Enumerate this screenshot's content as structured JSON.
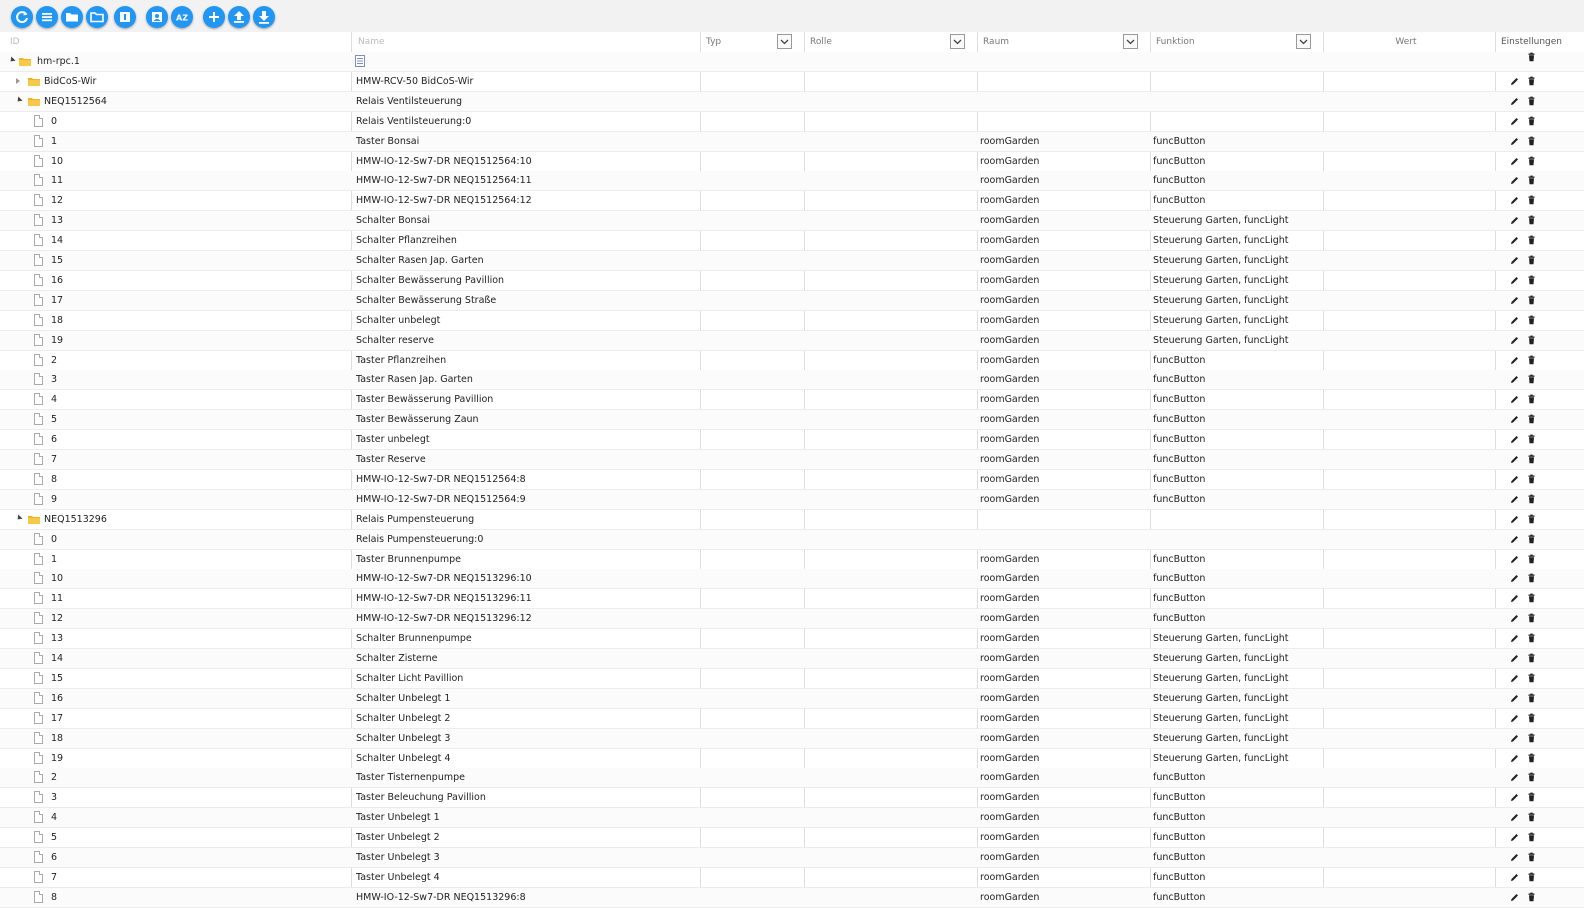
{
  "toolbar": {
    "buttons": [
      {
        "name": "refresh-button",
        "icon": "refresh-icon"
      },
      {
        "name": "list-view-button",
        "icon": "list-icon"
      },
      {
        "name": "collapse-folders-button",
        "icon": "folder-closed-icon"
      },
      {
        "name": "expand-folders-button",
        "icon": "folder-open-icon"
      },
      {
        "name": "column-toggle-button",
        "icon": "columns-icon"
      },
      {
        "name": "edit-person-button",
        "icon": "person-icon"
      },
      {
        "name": "sort-az-button",
        "icon": "sort-az-icon",
        "text": "AZ"
      },
      {
        "name": "add-object-button",
        "icon": "plus-icon"
      },
      {
        "name": "upload-button",
        "icon": "upload-icon"
      },
      {
        "name": "download-button",
        "icon": "download-icon"
      }
    ],
    "accent": "#2196f3"
  },
  "header": {
    "id_placeholder": "ID",
    "name_placeholder": "Name",
    "typ": "Typ",
    "rolle": "Rolle",
    "raum": "Raum",
    "funktion": "Funktion",
    "wert": "Wert",
    "einstellungen": "Einstellungen"
  },
  "rows": [
    {
      "id": "hm-rpc.1",
      "level": 0,
      "kind": "folder",
      "toggle": "open",
      "name": "",
      "name_icon": true,
      "raum": "",
      "funktion": "",
      "delete_only": true
    },
    {
      "id": "BidCoS-Wir",
      "level": 1,
      "kind": "folder",
      "toggle": "closed",
      "name": "HMW-RCV-50 BidCoS-Wir",
      "raum": "",
      "funktion": ""
    },
    {
      "id": "NEQ1512564",
      "level": 1,
      "kind": "folder",
      "toggle": "open",
      "name": "Relais Ventilsteuerung",
      "raum": "",
      "funktion": ""
    },
    {
      "id": "0",
      "level": 2,
      "kind": "file",
      "name": "Relais Ventilsteuerung:0",
      "raum": "",
      "funktion": ""
    },
    {
      "id": "1",
      "level": 2,
      "kind": "file",
      "name": "Taster Bonsai",
      "raum": "roomGarden",
      "funktion": "funcButton"
    },
    {
      "id": "10",
      "level": 2,
      "kind": "file",
      "name": "HMW-IO-12-Sw7-DR NEQ1512564:10",
      "raum": "roomGarden",
      "funktion": "funcButton"
    },
    {
      "id": "11",
      "level": 2,
      "kind": "file",
      "name": "HMW-IO-12-Sw7-DR NEQ1512564:11",
      "raum": "roomGarden",
      "funktion": "funcButton"
    },
    {
      "id": "12",
      "level": 2,
      "kind": "file",
      "name": "HMW-IO-12-Sw7-DR NEQ1512564:12",
      "raum": "roomGarden",
      "funktion": "funcButton"
    },
    {
      "id": "13",
      "level": 2,
      "kind": "file",
      "name": "Schalter Bonsai",
      "raum": "roomGarden",
      "funktion": "Steuerung Garten, funcLight"
    },
    {
      "id": "14",
      "level": 2,
      "kind": "file",
      "name": "Schalter Pflanzreihen",
      "raum": "roomGarden",
      "funktion": "Steuerung Garten, funcLight"
    },
    {
      "id": "15",
      "level": 2,
      "kind": "file",
      "name": "Schalter Rasen Jap. Garten",
      "raum": "roomGarden",
      "funktion": "Steuerung Garten, funcLight"
    },
    {
      "id": "16",
      "level": 2,
      "kind": "file",
      "name": "Schalter Bewässerung Pavillion",
      "raum": "roomGarden",
      "funktion": "Steuerung Garten, funcLight"
    },
    {
      "id": "17",
      "level": 2,
      "kind": "file",
      "name": "Schalter Bewässerung Straße",
      "raum": "roomGarden",
      "funktion": "Steuerung Garten, funcLight"
    },
    {
      "id": "18",
      "level": 2,
      "kind": "file",
      "name": "Schalter unbelegt",
      "raum": "roomGarden",
      "funktion": "Steuerung Garten, funcLight"
    },
    {
      "id": "19",
      "level": 2,
      "kind": "file",
      "name": "Schalter reserve",
      "raum": "roomGarden",
      "funktion": "Steuerung Garten, funcLight"
    },
    {
      "id": "2",
      "level": 2,
      "kind": "file",
      "name": "Taster Pflanzreihen",
      "raum": "roomGarden",
      "funktion": "funcButton"
    },
    {
      "id": "3",
      "level": 2,
      "kind": "file",
      "name": "Taster Rasen Jap. Garten",
      "raum": "roomGarden",
      "funktion": "funcButton"
    },
    {
      "id": "4",
      "level": 2,
      "kind": "file",
      "name": "Taster Bewässerung Pavillion",
      "raum": "roomGarden",
      "funktion": "funcButton"
    },
    {
      "id": "5",
      "level": 2,
      "kind": "file",
      "name": "Taster Bewässerung Zaun",
      "raum": "roomGarden",
      "funktion": "funcButton"
    },
    {
      "id": "6",
      "level": 2,
      "kind": "file",
      "name": "Taster unbelegt",
      "raum": "roomGarden",
      "funktion": "funcButton"
    },
    {
      "id": "7",
      "level": 2,
      "kind": "file",
      "name": "Taster Reserve",
      "raum": "roomGarden",
      "funktion": "funcButton"
    },
    {
      "id": "8",
      "level": 2,
      "kind": "file",
      "name": "HMW-IO-12-Sw7-DR NEQ1512564:8",
      "raum": "roomGarden",
      "funktion": "funcButton"
    },
    {
      "id": "9",
      "level": 2,
      "kind": "file",
      "name": "HMW-IO-12-Sw7-DR NEQ1512564:9",
      "raum": "roomGarden",
      "funktion": "funcButton"
    },
    {
      "id": "NEQ1513296",
      "level": 1,
      "kind": "folder",
      "toggle": "open",
      "name": "Relais Pumpensteuerung",
      "raum": "",
      "funktion": ""
    },
    {
      "id": "0",
      "level": 2,
      "kind": "file",
      "name": "Relais Pumpensteuerung:0",
      "raum": "",
      "funktion": ""
    },
    {
      "id": "1",
      "level": 2,
      "kind": "file",
      "name": "Taster Brunnenpumpe",
      "raum": "roomGarden",
      "funktion": "funcButton"
    },
    {
      "id": "10",
      "level": 2,
      "kind": "file",
      "name": "HMW-IO-12-Sw7-DR NEQ1513296:10",
      "raum": "roomGarden",
      "funktion": "funcButton"
    },
    {
      "id": "11",
      "level": 2,
      "kind": "file",
      "name": "HMW-IO-12-Sw7-DR NEQ1513296:11",
      "raum": "roomGarden",
      "funktion": "funcButton"
    },
    {
      "id": "12",
      "level": 2,
      "kind": "file",
      "name": "HMW-IO-12-Sw7-DR NEQ1513296:12",
      "raum": "roomGarden",
      "funktion": "funcButton"
    },
    {
      "id": "13",
      "level": 2,
      "kind": "file",
      "name": "Schalter Brunnenpumpe",
      "raum": "roomGarden",
      "funktion": "Steuerung Garten, funcLight"
    },
    {
      "id": "14",
      "level": 2,
      "kind": "file",
      "name": "Schalter Zisterne",
      "raum": "roomGarden",
      "funktion": "Steuerung Garten, funcLight"
    },
    {
      "id": "15",
      "level": 2,
      "kind": "file",
      "name": "Schalter Licht Pavillion",
      "raum": "roomGarden",
      "funktion": "Steuerung Garten, funcLight"
    },
    {
      "id": "16",
      "level": 2,
      "kind": "file",
      "name": "Schalter Unbelegt 1",
      "raum": "roomGarden",
      "funktion": "Steuerung Garten, funcLight"
    },
    {
      "id": "17",
      "level": 2,
      "kind": "file",
      "name": "Schalter Unbelegt 2",
      "raum": "roomGarden",
      "funktion": "Steuerung Garten, funcLight"
    },
    {
      "id": "18",
      "level": 2,
      "kind": "file",
      "name": "Schalter Unbelegt 3",
      "raum": "roomGarden",
      "funktion": "Steuerung Garten, funcLight"
    },
    {
      "id": "19",
      "level": 2,
      "kind": "file",
      "name": "Schalter Unbelegt 4",
      "raum": "roomGarden",
      "funktion": "Steuerung Garten, funcLight"
    },
    {
      "id": "2",
      "level": 2,
      "kind": "file",
      "name": "Taster Tisternenpumpe",
      "raum": "roomGarden",
      "funktion": "funcButton"
    },
    {
      "id": "3",
      "level": 2,
      "kind": "file",
      "name": "Taster Beleuchung Pavillion",
      "raum": "roomGarden",
      "funktion": "funcButton"
    },
    {
      "id": "4",
      "level": 2,
      "kind": "file",
      "name": "Taster Unbelegt 1",
      "raum": "roomGarden",
      "funktion": "funcButton"
    },
    {
      "id": "5",
      "level": 2,
      "kind": "file",
      "name": "Taster Unbelegt 2",
      "raum": "roomGarden",
      "funktion": "funcButton"
    },
    {
      "id": "6",
      "level": 2,
      "kind": "file",
      "name": "Taster Unbelegt 3",
      "raum": "roomGarden",
      "funktion": "funcButton"
    },
    {
      "id": "7",
      "level": 2,
      "kind": "file",
      "name": "Taster Unbelegt 4",
      "raum": "roomGarden",
      "funktion": "funcButton"
    },
    {
      "id": "8",
      "level": 2,
      "kind": "file",
      "name": "HMW-IO-12-Sw7-DR NEQ1513296:8",
      "raum": "roomGarden",
      "funktion": "funcButton"
    }
  ]
}
